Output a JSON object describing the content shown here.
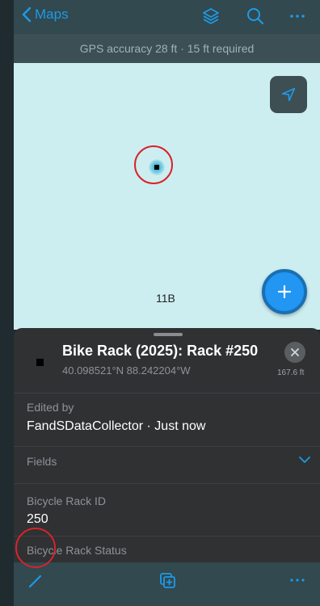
{
  "nav": {
    "back_label": "Maps"
  },
  "gps": {
    "text": "GPS accuracy 28 ft  ·  15 ft required"
  },
  "map": {
    "label": "11B"
  },
  "feature": {
    "title": "Bike Rack (2025): Rack #250",
    "coords": "40.098521°N  88.242204°W",
    "distance": "167.6 ft"
  },
  "edited": {
    "label": "Edited by",
    "value": "FandSDataCollector · Just now"
  },
  "fields": {
    "label": "Fields"
  },
  "attributes": [
    {
      "label": "Bicycle Rack ID",
      "value": "250"
    },
    {
      "label": "Bicycle Rack Status",
      "value": ""
    }
  ],
  "colors": {
    "accent": "#1e9ae6",
    "fab": "#2196f3",
    "highlight": "#d8232c"
  }
}
